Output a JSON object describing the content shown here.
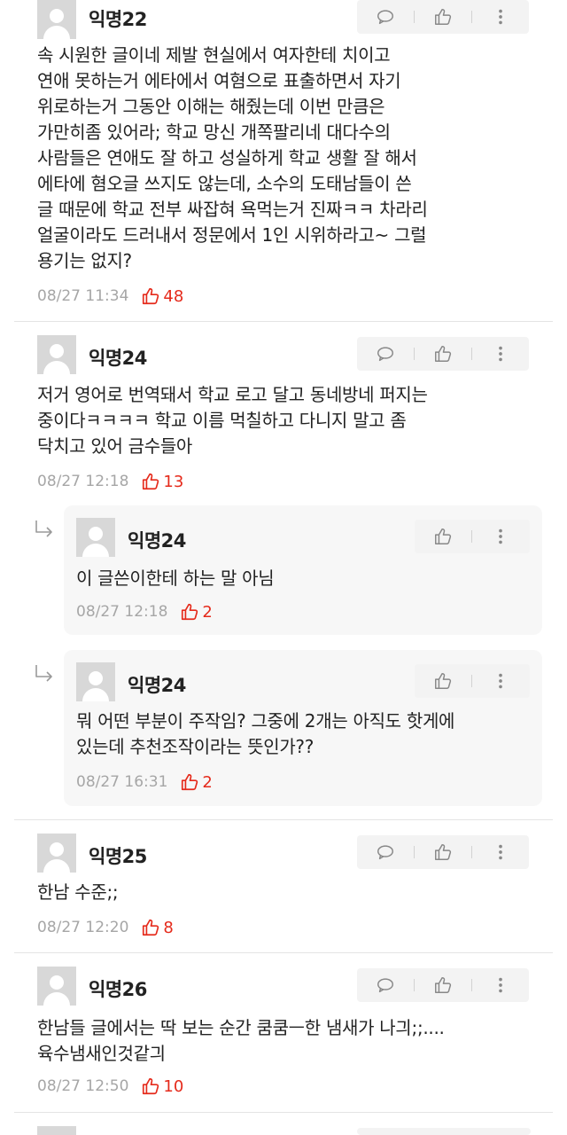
{
  "comments": [
    {
      "author": "익명22",
      "text": "속 시원한 글이네 제발 현실에서 여자한테 치이고\n연애 못하는거 에타에서 여혐으로 표출하면서 자기\n위로하는거 그동안 이해는 해줬는데 이번 만큼은\n가만히좀 있어라; 학교 망신 개쪽팔리네 대다수의\n사람들은 연애도 잘 하고 성실하게 학교 생활 잘 해서\n에타에 혐오글 쓰지도 않는데, 소수의 도태남들이 쓴\n글 때문에 학교 전부 싸잡혀 욕먹는거 진짜ㅋㅋ 차라리\n얼굴이라도 드러내서 정문에서 1인 시위하라고~ 그럴\n용기는 없지?",
      "date": "08/27 11:34",
      "likes": "48"
    },
    {
      "author": "익명24",
      "text": "저거 영어로 번역돼서 학교 로고 달고 동네방네 퍼지는\n중이다ㅋㅋㅋㅋ 학교 이름 먹칠하고 다니지 말고 좀\n닥치고 있어 금수들아",
      "date": "08/27 12:18",
      "likes": "13"
    },
    {
      "author": "익명25",
      "text": "한남 수준;;",
      "date": "08/27 12:20",
      "likes": "8"
    },
    {
      "author": "익명26",
      "text": "한남들 글에서는 딱 보는 순간 쿰쿰ㅡ한 냄새가 나긔;;....\n육수냄새인것같긔",
      "date": "08/27 12:50",
      "likes": "10"
    }
  ],
  "replies": [
    {
      "author": "익명24",
      "text": "이 글쓴이한테 하는 말 아님",
      "date": "08/27 12:18",
      "likes": "2"
    },
    {
      "author": "익명24",
      "text": "뭐 어떤 부분이 주작임? 그중에 2개는 아직도 핫게에\n있는데 추천조작이라는 뜻인가??",
      "date": "08/27 16:31",
      "likes": "2"
    }
  ],
  "icons": {
    "comment": "speech-bubble-icon",
    "like": "thumbs-up-icon",
    "more": "more-vertical-icon",
    "reply": "reply-arrow-icon"
  },
  "colors": {
    "like_red": "#e52a1b",
    "meta_gray": "#a6a6a6",
    "action_bg": "#f3f3f3",
    "reply_bg": "#f7f7f7"
  }
}
